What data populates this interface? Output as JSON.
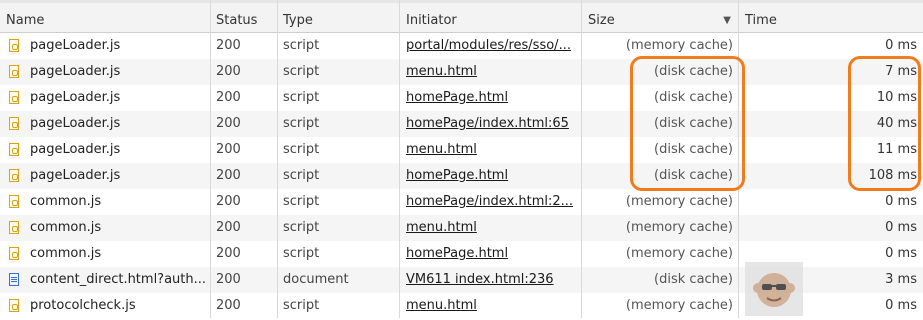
{
  "columns": {
    "name": "Name",
    "status": "Status",
    "type": "Type",
    "initiator": "Initiator",
    "size": "Size",
    "time": "Time"
  },
  "sort_indicator": "▼",
  "rows": [
    {
      "name": "pageLoader.js",
      "status": "200",
      "type": "script",
      "initiator": "portal/modules/res/sso/...",
      "size": "(memory cache)",
      "time": "0 ms",
      "icon": "js-file-icon"
    },
    {
      "name": "pageLoader.js",
      "status": "200",
      "type": "script",
      "initiator": "menu.html",
      "size": "(disk cache)",
      "time": "7 ms",
      "icon": "js-file-icon"
    },
    {
      "name": "pageLoader.js",
      "status": "200",
      "type": "script",
      "initiator": "homePage.html",
      "size": "(disk cache)",
      "time": "10 ms",
      "icon": "js-file-icon"
    },
    {
      "name": "pageLoader.js",
      "status": "200",
      "type": "script",
      "initiator": "homePage/index.html:65",
      "size": "(disk cache)",
      "time": "40 ms",
      "icon": "js-file-icon"
    },
    {
      "name": "pageLoader.js",
      "status": "200",
      "type": "script",
      "initiator": "menu.html",
      "size": "(disk cache)",
      "time": "11 ms",
      "icon": "js-file-icon"
    },
    {
      "name": "pageLoader.js",
      "status": "200",
      "type": "script",
      "initiator": "homePage.html",
      "size": "(disk cache)",
      "time": "108 ms",
      "icon": "js-file-icon"
    },
    {
      "name": "common.js",
      "status": "200",
      "type": "script",
      "initiator": "homePage/index.html:2...",
      "size": "(memory cache)",
      "time": "0 ms",
      "icon": "js-file-icon"
    },
    {
      "name": "common.js",
      "status": "200",
      "type": "script",
      "initiator": "menu.html",
      "size": "(memory cache)",
      "time": "0 ms",
      "icon": "js-file-icon"
    },
    {
      "name": "common.js",
      "status": "200",
      "type": "script",
      "initiator": "homePage.html",
      "size": "(memory cache)",
      "time": "0 ms",
      "icon": "js-file-icon"
    },
    {
      "name": "content_direct.html?auth...",
      "status": "200",
      "type": "document",
      "initiator": "VM611 index.html:236",
      "size": "(disk cache)",
      "time": "3 ms",
      "icon": "document-file-icon"
    },
    {
      "name": "protocolcheck.js",
      "status": "200",
      "type": "script",
      "initiator": "menu.html",
      "size": "(memory cache)",
      "time": "0 ms",
      "icon": "js-file-icon"
    }
  ],
  "colors": {
    "highlight": "#f07c1e",
    "row_alt": "#f5f5f5",
    "header_bg": "#f3f3f3"
  }
}
